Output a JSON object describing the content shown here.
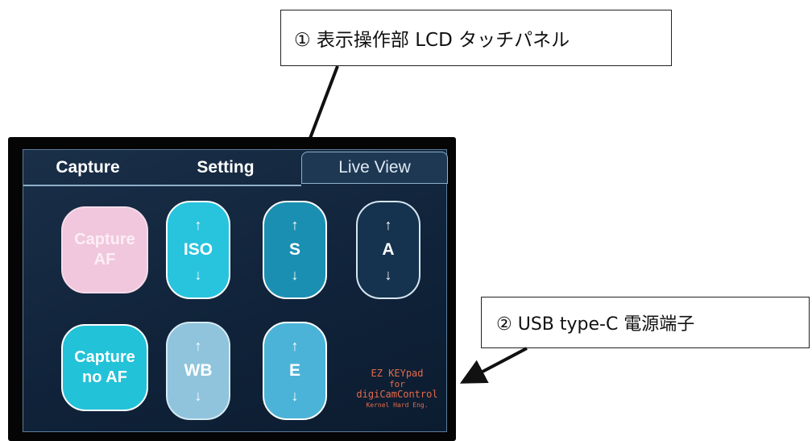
{
  "callouts": {
    "lcd": "① 表示操作部 LCD タッチパネル",
    "usb": "② USB type-C 電源端子"
  },
  "tabs": {
    "capture": "Capture",
    "setting": "Setting",
    "live_view": "Live View"
  },
  "keys": {
    "capture_af": {
      "line1": "Capture",
      "line2": "AF"
    },
    "capture_no_af": {
      "line1": "Capture",
      "line2": "no AF"
    },
    "iso": {
      "up": "↑",
      "label": "ISO",
      "down": "↓"
    },
    "s": {
      "up": "↑",
      "label": "S",
      "down": "↓"
    },
    "a": {
      "up": "↑",
      "label": "A",
      "down": "↓"
    },
    "wb": {
      "up": "↑",
      "label": "WB",
      "down": "↓"
    },
    "e": {
      "up": "↑",
      "label": "E",
      "down": "↓"
    }
  },
  "branding": {
    "line1": "EZ KEYpad",
    "line2": "for",
    "line3": "digiCamControl",
    "line4": "Kernel Hard Eng."
  },
  "colors": {
    "capture_af": "#f0c7dc",
    "iso": "#28c3dd",
    "s": "#1b8fb2",
    "a": "#15324e",
    "capture_no_af": "#22c2d8",
    "wb": "#8fc4dc",
    "e": "#4cb3d8",
    "branding_text": "#e56a4a"
  }
}
